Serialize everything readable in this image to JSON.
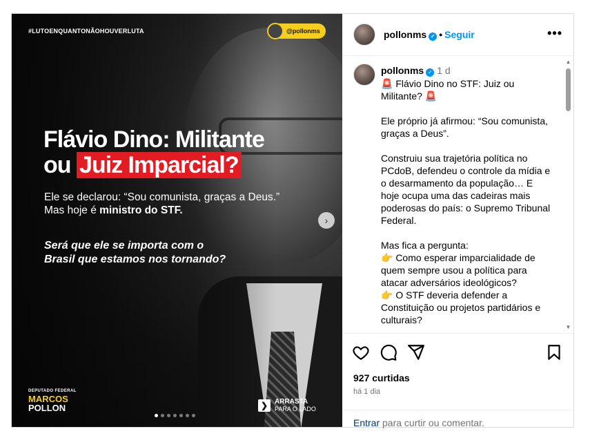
{
  "post": {
    "hashtag": "#LUTOENQUANTONÃOHOUVERLUTA",
    "handle_tag": "@pollonms",
    "headline_line1": "Flávio Dino: Militante",
    "headline_line2_prefix": "ou ",
    "headline_highlight": "Juiz Imparcial?",
    "sub_line1": "Ele se declarou: “Sou comunista, graças a Deus.”",
    "sub_line2_prefix": "Mas hoje é ",
    "sub_line2_bold": "ministro do STF.",
    "question_line1": "Será que ele se importa com o",
    "question_line2": "Brasil que estamos nos tornando?",
    "logo_small": "DEPUTADO FEDERAL",
    "logo_name1": "MARCOS",
    "logo_name2": "POLLON",
    "swipe_line1": "ARRASTA",
    "swipe_line2": "PARA O LADO",
    "next_arrow": "›",
    "carousel_total": 7,
    "carousel_active": 0
  },
  "header": {
    "username": "pollonms",
    "separator": "•",
    "follow_label": "Seguir",
    "more_label": "•••"
  },
  "caption": {
    "username": "pollonms",
    "time": "1 d",
    "text": "🚨 Flávio Dino no STF: Juiz ou Militante? 🚨\n\nEle próprio já afirmou: “Sou comunista, graças a Deus”.\n\nConstruiu sua trajetória política no PCdoB, defendeu o controle da mídia e o desarmamento da população… E hoje ocupa uma das cadeiras mais poderosas do país: o Supremo Tribunal Federal.\n\nMas fica a pergunta:\n👉 Como esperar imparcialidade de quem sempre usou a política para atacar adversários ideológicos?\n👉 O STF deveria defender a Constituição ou projetos partidários e culturais?"
  },
  "actions": {
    "likes": "927 curtidas",
    "ago": "há 1 dia"
  },
  "comment": {
    "login_label": "Entrar",
    "rest": " para curtir ou comentar."
  },
  "colors": {
    "accent_blue": "#0095f6",
    "highlight_red": "#e31b23",
    "brand_yellow": "#f5cf1b"
  }
}
